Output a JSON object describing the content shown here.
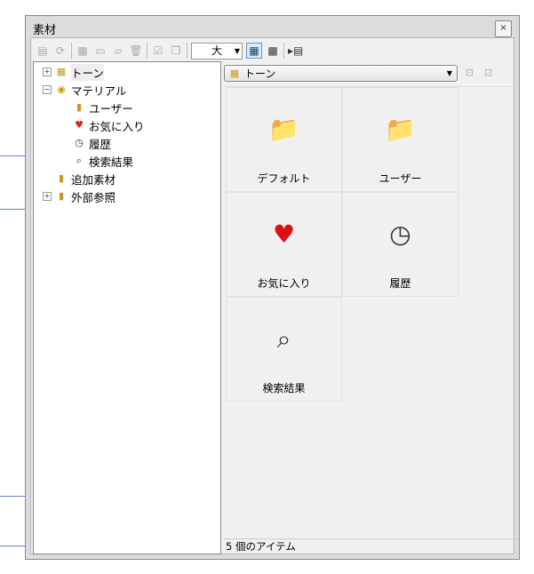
{
  "window": {
    "title": "素材",
    "close": "×"
  },
  "toolbar": {
    "size_value": "大"
  },
  "tree": [
    {
      "label": "トーン",
      "expander": "+",
      "icon": "▦"
    },
    {
      "label": "マテリアル",
      "expander": "−",
      "icon": "◉"
    },
    {
      "label": "ユーザー",
      "icon": "▮"
    },
    {
      "label": "お気に入り",
      "icon": "♥"
    },
    {
      "label": "履歴",
      "icon": "◷"
    },
    {
      "label": "検索結果",
      "icon": "⌕"
    },
    {
      "label": "追加素材",
      "icon": "▮"
    },
    {
      "label": "外部参照",
      "expander": "+",
      "icon": "▮"
    }
  ],
  "location": {
    "value": "トーン"
  },
  "items": [
    {
      "label": "デフォルト",
      "icon": "📁"
    },
    {
      "label": "ユーザー",
      "icon": "📁"
    },
    {
      "label": "お気に入り",
      "icon": "♥"
    },
    {
      "label": "履歴",
      "icon": "◷"
    },
    {
      "label": "検索結果",
      "icon": "⌕"
    }
  ],
  "status": "5 個のアイテム"
}
